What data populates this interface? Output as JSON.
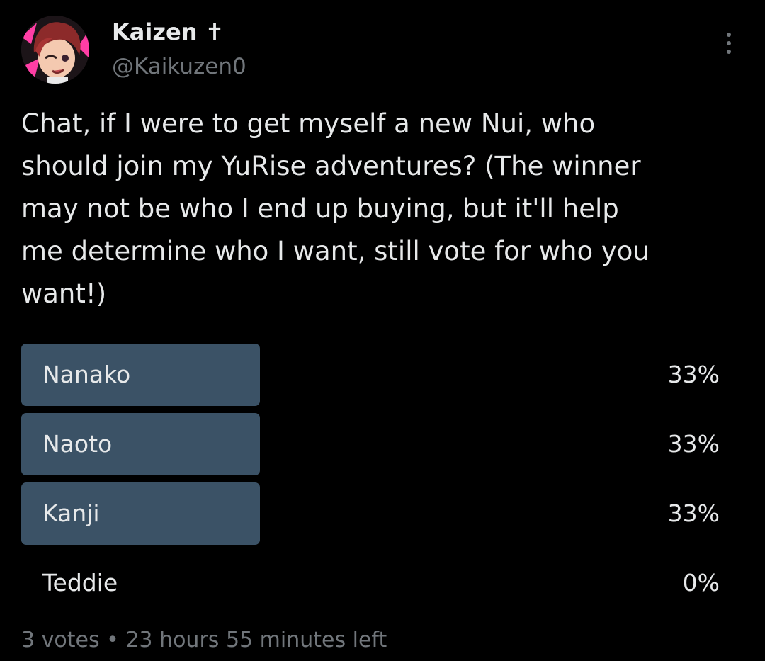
{
  "author": {
    "name": "Kaizen ✝",
    "handle": "@Kaikuzen0"
  },
  "tweet": {
    "text": "Chat, if I were to get myself a new Nui, who\nshould join my YuRise adventures? (The winner\nmay not be who I end up buying, but it'll help\nme determine who I want, still vote for who you\nwant!)"
  },
  "poll": {
    "options": [
      {
        "label": "Nanako",
        "percent": "33%",
        "fraction": 0.33
      },
      {
        "label": "Naoto",
        "percent": "33%",
        "fraction": 0.33
      },
      {
        "label": "Kanji",
        "percent": "33%",
        "fraction": 0.33
      },
      {
        "label": "Teddie",
        "percent": "0%",
        "fraction": 0
      }
    ],
    "footer": "3 votes • 23 hours 55 minutes left"
  },
  "colors": {
    "background": "#000000",
    "text_primary": "#e7e9ea",
    "text_secondary": "#71767b",
    "poll_bar": "#3b5266",
    "avatar_accent": "#ff3ea5"
  },
  "icons": {
    "more": "more-vertical-icon",
    "avatar": "anime-character-avatar"
  }
}
